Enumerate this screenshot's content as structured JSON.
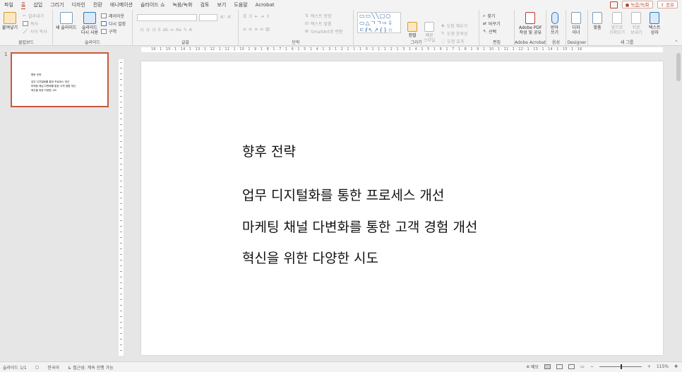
{
  "menu": {
    "tabs": [
      "파일",
      "홈",
      "삽입",
      "그리기",
      "디자인",
      "전환",
      "애니메이션",
      "슬라이드 쇼",
      "녹음/녹화",
      "검토",
      "보기",
      "도움말",
      "Acrobat"
    ],
    "active_tab": "홈",
    "record_button": "녹음/녹화",
    "share_button": "공유"
  },
  "ribbon": {
    "clipboard": {
      "paste": "붙여넣기",
      "cut": "잘라내기",
      "copy": "복사",
      "format_painter": "서식 복사",
      "group_label": "클립보드"
    },
    "slides": {
      "new_slide": "새 슬라이드",
      "reuse_slides_line1": "슬라이드",
      "reuse_slides_line2": "다시 사용",
      "layout": "레이아웃",
      "reset": "다시 설정",
      "section": "구역",
      "group_label": "슬라이드"
    },
    "font": {
      "group_label": "글꼴"
    },
    "paragraph": {
      "text_direction": "텍스트 방향",
      "align_text": "텍스트 맞춤",
      "smartart": "SmartArt로 변환",
      "group_label": "단락"
    },
    "drawing": {
      "arrange": "정렬",
      "quick_styles_line1": "빠른",
      "quick_styles_line2": "스타일",
      "shape_fill": "도형 채우기",
      "shape_outline": "도형 윤곽선",
      "shape_effects": "도형 효과",
      "group_label": "그리기"
    },
    "editing": {
      "find": "찾기",
      "replace": "바꾸기",
      "select": "선택",
      "group_label": "편집"
    },
    "acrobat": {
      "btn_line1": "Adobe PDF",
      "btn_line2": "작성 및 공유",
      "group_label": "Adobe Acrobat"
    },
    "voice": {
      "btn_line1": "받아",
      "btn_line2": "쓰기",
      "group_label": "음성"
    },
    "designer": {
      "btn_line1": "디자",
      "btn_line2": "이너",
      "group_label": "Designer"
    },
    "new_group": {
      "align": "맞춤",
      "bring_forward_line1": "앞으로",
      "bring_forward_line2": "가져오기",
      "send_backward_line1": "뒤로",
      "send_backward_line2": "보내기",
      "textbox_line1": "텍스트",
      "textbox_line2": "상자",
      "group_label": "새 그룹"
    }
  },
  "ruler": {
    "horizontal": "16 · 1 · 15 · 1 · 14 · 1 · 13 · 1 · 12 · 1 · 11 · 1 · 10 · 1 · 9 · 1 · 8 · 1 · 7 · 1 · 6 · 1 · 5 · 1 · 4 · 1 · 3 · 1 · 2 · 1 · 1 · 1 · 0 · 1 · 1 · 1 · 2 · 1 · 3 · 1 · 4 · 1 · 5 · 1 · 6 · 1 · 7 · 1 · 8 · 1 · 9 · 1 · 10 · 1 · 11 · 1 · 12 · 1 · 13 · 1 · 14 · 1 · 15 · 1 · 16"
  },
  "thumbnail": {
    "number": "1"
  },
  "slide": {
    "title": "향후 전략",
    "lines": [
      "업무 디지털화를 통한 프로세스 개선",
      "마케팅 채널 다변화를 통한 고객 경험 개선",
      "혁신을 위한 다양한 시도"
    ]
  },
  "status": {
    "slide_count": "슬라이드 1/1",
    "language": "한국어",
    "accessibility": "접근성: 계속 진행 가능",
    "notes": "메모",
    "zoom": "115%"
  },
  "colors": {
    "accent": "#b7472a",
    "thumb_border": "#c55a3f"
  }
}
